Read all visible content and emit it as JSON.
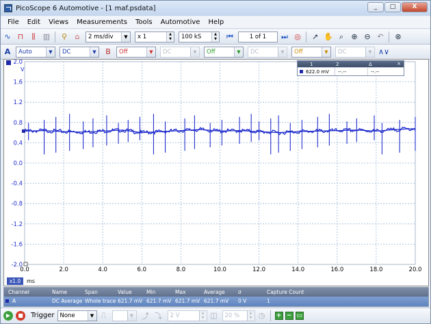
{
  "title": "PicoScope 6 Automotive - [1 maf.psdata]",
  "window_buttons": {
    "minimize": "_",
    "maximize": "□",
    "close": "X"
  },
  "menu": [
    "File",
    "Edit",
    "Views",
    "Measurements",
    "Tools",
    "Automotive",
    "Help"
  ],
  "toolbar": {
    "timebase": "2 ms/div",
    "zoom": "x 1",
    "samples": "100 kS",
    "page": "1 of 1"
  },
  "channel_bar": {
    "range": "Auto",
    "coupling": "DC",
    "channel_b_state": "Off",
    "channel_b_coupling": "DC",
    "channel_c_state": "Off",
    "channel_c_coupling": "DC",
    "channel_d_state": "Off",
    "channel_d_coupling": "DC",
    "channel_a_label": "A",
    "channel_b_label": "B"
  },
  "chart_data": {
    "type": "line",
    "y_unit": "V",
    "x_unit": "ms",
    "xlim": [
      0,
      20
    ],
    "ylim": [
      -2,
      2
    ],
    "x_ticks": [
      "0.0",
      "2.0",
      "4.0",
      "6.0",
      "8.0",
      "10.0",
      "12.0",
      "14.0",
      "16.0",
      "18.0",
      "20.0"
    ],
    "y_ticks": [
      "2.0",
      "1.6",
      "1.2",
      "0.8",
      "0.4",
      "0.0",
      "-0.4",
      "-0.8",
      "-1.2",
      "-1.6",
      "-2.0"
    ],
    "zoom_badge": "x1.0",
    "grid": true,
    "trace_color": "#1f2ccc",
    "series": [
      {
        "x": [
          0,
          1,
          2,
          3,
          4,
          5,
          6,
          7,
          8,
          9,
          10,
          11,
          12,
          13,
          14,
          15,
          16,
          17,
          18,
          19,
          20
        ],
        "y": [
          0.63,
          0.64,
          0.62,
          0.61,
          0.63,
          0.65,
          0.6,
          0.62,
          0.64,
          0.66,
          0.63,
          0.64,
          0.62,
          0.6,
          0.62,
          0.63,
          0.64,
          0.65,
          0.63,
          0.66,
          0.68
        ]
      }
    ],
    "spikes_ms": [
      0.2,
      1.0,
      1.6,
      2.3,
      3.0,
      3.5,
      4.2,
      4.8,
      5.3,
      5.9,
      6.6,
      7.2,
      8.2,
      8.7,
      9.5,
      10.1,
      11.0,
      11.6,
      12.0,
      12.6,
      13.0,
      13.6,
      14.2,
      15.0,
      15.6,
      16.5,
      17.0,
      17.9,
      18.3,
      19.2,
      20.0
    ]
  },
  "ruler": {
    "col1": "1",
    "col2": "2",
    "col3": "Δ",
    "val1": "622.0 mV",
    "val2": "--.--",
    "val3": "--.--"
  },
  "measurements": {
    "headers": [
      "Channel",
      "Name",
      "Span",
      "Value",
      "Min",
      "Max",
      "Average",
      "σ",
      "Capture Count"
    ],
    "row": [
      "A",
      "DC Average",
      "Whole trace",
      "621.7 mV",
      "621.7 mV",
      "621.7 mV",
      "621.7 mV",
      "0 V",
      "1"
    ]
  },
  "bottom": {
    "trigger_label": "Trigger",
    "trigger_mode": "None",
    "level": "2 V",
    "percent": "20 %"
  }
}
